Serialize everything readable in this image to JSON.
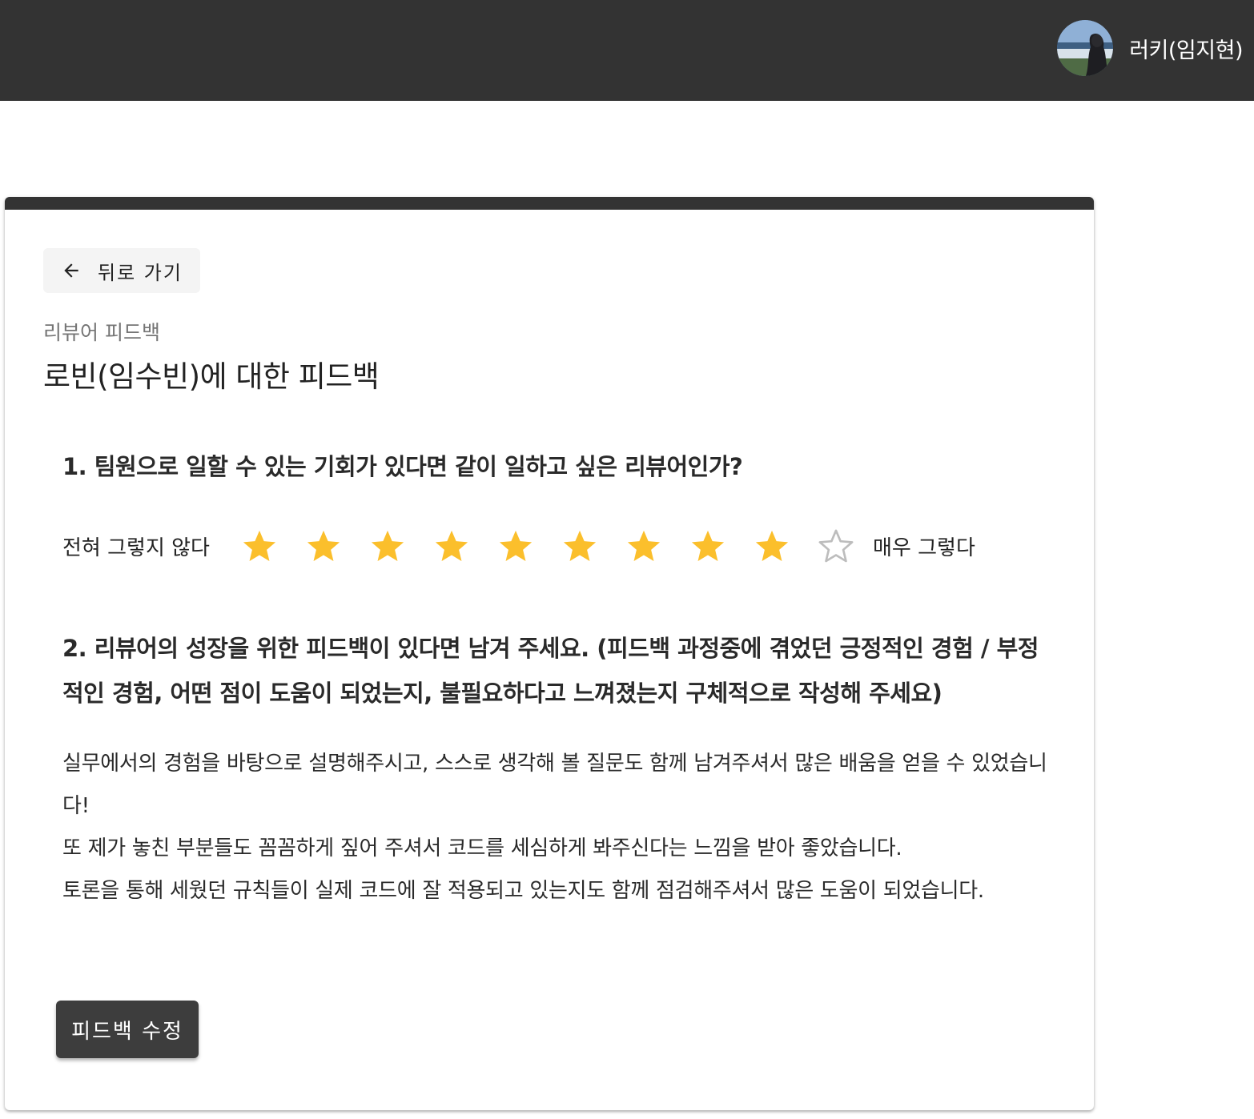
{
  "header": {
    "user_name": "러키(임지현)",
    "avatar_icon": "user-avatar-photo"
  },
  "card": {
    "back_label": "뒤로 가기",
    "back_icon": "arrow-left-icon",
    "subtitle": "리뷰어 피드백",
    "title": "로빈(임수빈)에 대한 피드백"
  },
  "question1": {
    "text": "1. 팀원으로 일할 수 있는 기회가 있다면 같이 일하고 싶은 리뷰어인가?",
    "low_label": "전혀 그렇지 않다",
    "high_label": "매우 그렇다",
    "rating": 9,
    "max_rating": 10
  },
  "question2": {
    "text": "2. 리뷰어의 성장을 위한 피드백이 있다면 남겨 주세요. (피드백 과정중에 겪었던 긍정적인 경험 / 부정적인 경험, 어떤 점이 도움이 되었는지, 불필요하다고 느껴졌는지 구체적으로 작성해 주세요)",
    "answer_lines": [
      "실무에서의 경험을 바탕으로 설명해주시고, 스스로 생각해 볼 질문도 함께 남겨주셔서 많은 배움을 얻을 수 있었습니다!",
      "또 제가 놓친 부분들도 꼼꼼하게 짚어 주셔서 코드를 세심하게 봐주신다는 느낌을 받아 좋았습니다.",
      "토론을 통해 세웠던 규칙들이 실제 코드에 잘 적용되고 있는지도 함께 점검해주셔서 많은 도움이 되었습니다."
    ]
  },
  "actions": {
    "edit_label": "피드백 수정"
  },
  "colors": {
    "header_bg": "#333333",
    "star_filled": "#FBBF2C",
    "star_empty": "#BDBDBD",
    "button_bg": "#3D3D3D"
  }
}
